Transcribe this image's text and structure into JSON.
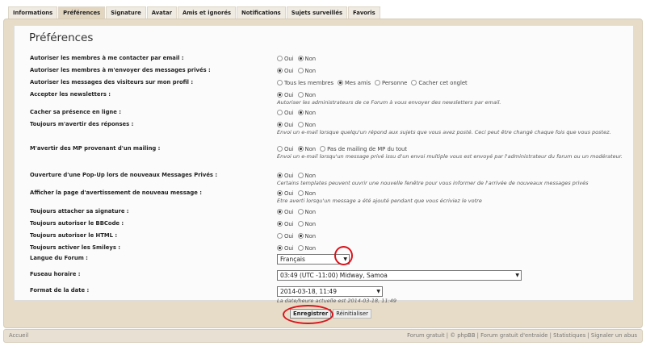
{
  "tabs": [
    {
      "label": "Informations",
      "active": false
    },
    {
      "label": "Préférences",
      "active": true
    },
    {
      "label": "Signature",
      "active": false
    },
    {
      "label": "Avatar",
      "active": false
    },
    {
      "label": "Amis et ignorés",
      "active": false
    },
    {
      "label": "Notifications",
      "active": false
    },
    {
      "label": "Sujets surveillés",
      "active": false
    },
    {
      "label": "Favoris",
      "active": false
    }
  ],
  "page_title": "Préférences",
  "settings": [
    {
      "label": "Autoriser les membres à me contacter par email :",
      "options": [
        {
          "text": "Oui",
          "checked": false
        },
        {
          "text": "Non",
          "checked": true
        }
      ],
      "desc": ""
    },
    {
      "label": "Autoriser les membres à m'envoyer des messages privés :",
      "options": [
        {
          "text": "Oui",
          "checked": true
        },
        {
          "text": "Non",
          "checked": false
        }
      ],
      "desc": ""
    },
    {
      "label": "Autoriser les messages des visiteurs sur mon profil :",
      "options": [
        {
          "text": "Tous les membres",
          "checked": false
        },
        {
          "text": "Mes amis",
          "checked": true
        },
        {
          "text": "Personne",
          "checked": false
        },
        {
          "text": "Cacher cet onglet",
          "checked": false
        }
      ],
      "desc": ""
    },
    {
      "label": "Accepter les newsletters :",
      "options": [
        {
          "text": "Oui",
          "checked": true
        },
        {
          "text": "Non",
          "checked": false
        }
      ],
      "desc": "Autoriser les administrateurs de ce Forum à vous envoyer des newsletters par email."
    },
    {
      "label": "Cacher sa présence en ligne :",
      "options": [
        {
          "text": "Oui",
          "checked": false
        },
        {
          "text": "Non",
          "checked": true
        }
      ],
      "desc": ""
    },
    {
      "label": "Toujours m'avertir des réponses :",
      "options": [
        {
          "text": "Oui",
          "checked": true
        },
        {
          "text": "Non",
          "checked": false
        }
      ],
      "desc": "Envoi un e-mail lorsque quelqu'un répond aux sujets que vous avez posté. Ceci peut être changé chaque fois que vous postez."
    },
    {
      "label": "M'avertir des MP provenant d'un mailing :",
      "options": [
        {
          "text": "Oui",
          "checked": false
        },
        {
          "text": "Non",
          "checked": true
        },
        {
          "text": "Pas de mailing de MP du tout",
          "checked": false
        }
      ],
      "desc": "Envoi un e-mail lorsqu'un message privé issu d'un envoi multiple vous est envoyé par l'administrateur du forum ou un modérateur."
    },
    {
      "label": "Ouverture d'une Pop-Up lors de nouveaux Messages Privés :",
      "options": [
        {
          "text": "Oui",
          "checked": true
        },
        {
          "text": "Non",
          "checked": false
        }
      ],
      "desc": "Certains templates peuvent ouvrir une nouvelle fenêtre pour vous informer de l'arrivée de nouveaux messages privés"
    },
    {
      "label": "Afficher la page d'avertissement de nouveau message :",
      "options": [
        {
          "text": "Oui",
          "checked": true
        },
        {
          "text": "Non",
          "checked": false
        }
      ],
      "desc": "Etre averti lorsqu'un message a été ajouté pendant que vous écriviez le votre"
    },
    {
      "label": "Toujours attacher sa signature :",
      "options": [
        {
          "text": "Oui",
          "checked": true
        },
        {
          "text": "Non",
          "checked": false
        }
      ],
      "desc": ""
    },
    {
      "label": "Toujours autoriser le BBCode :",
      "options": [
        {
          "text": "Oui",
          "checked": true
        },
        {
          "text": "Non",
          "checked": false
        }
      ],
      "desc": ""
    },
    {
      "label": "Toujours autoriser le HTML :",
      "options": [
        {
          "text": "Oui",
          "checked": false
        },
        {
          "text": "Non",
          "checked": true
        }
      ],
      "desc": ""
    },
    {
      "label": "Toujours activer les Smileys :",
      "options": [
        {
          "text": "Oui",
          "checked": true
        },
        {
          "text": "Non",
          "checked": false
        }
      ],
      "desc": ""
    }
  ],
  "language": {
    "label": "Langue du Forum :",
    "value": "Français"
  },
  "timezone": {
    "label": "Fuseau horaire :",
    "value": "03:49 (UTC -11:00) Midway, Samoa"
  },
  "date_format": {
    "label": "Format de la date :",
    "value": "2014-03-18, 11:49",
    "desc": "La date/heure actuelle est 2014-03-18, 11:49"
  },
  "buttons": {
    "save": "Enregistrer",
    "reset": "Réinitialiser"
  },
  "footer": {
    "home": "Accueil",
    "links": [
      "Forum gratuit",
      "© phpBB",
      "Forum gratuit d'entraide",
      "Statistiques",
      "Signaler un abus"
    ],
    "separator": " | "
  },
  "colors": {
    "accent": "#e7dcc8",
    "highlight": "#d8141c"
  }
}
